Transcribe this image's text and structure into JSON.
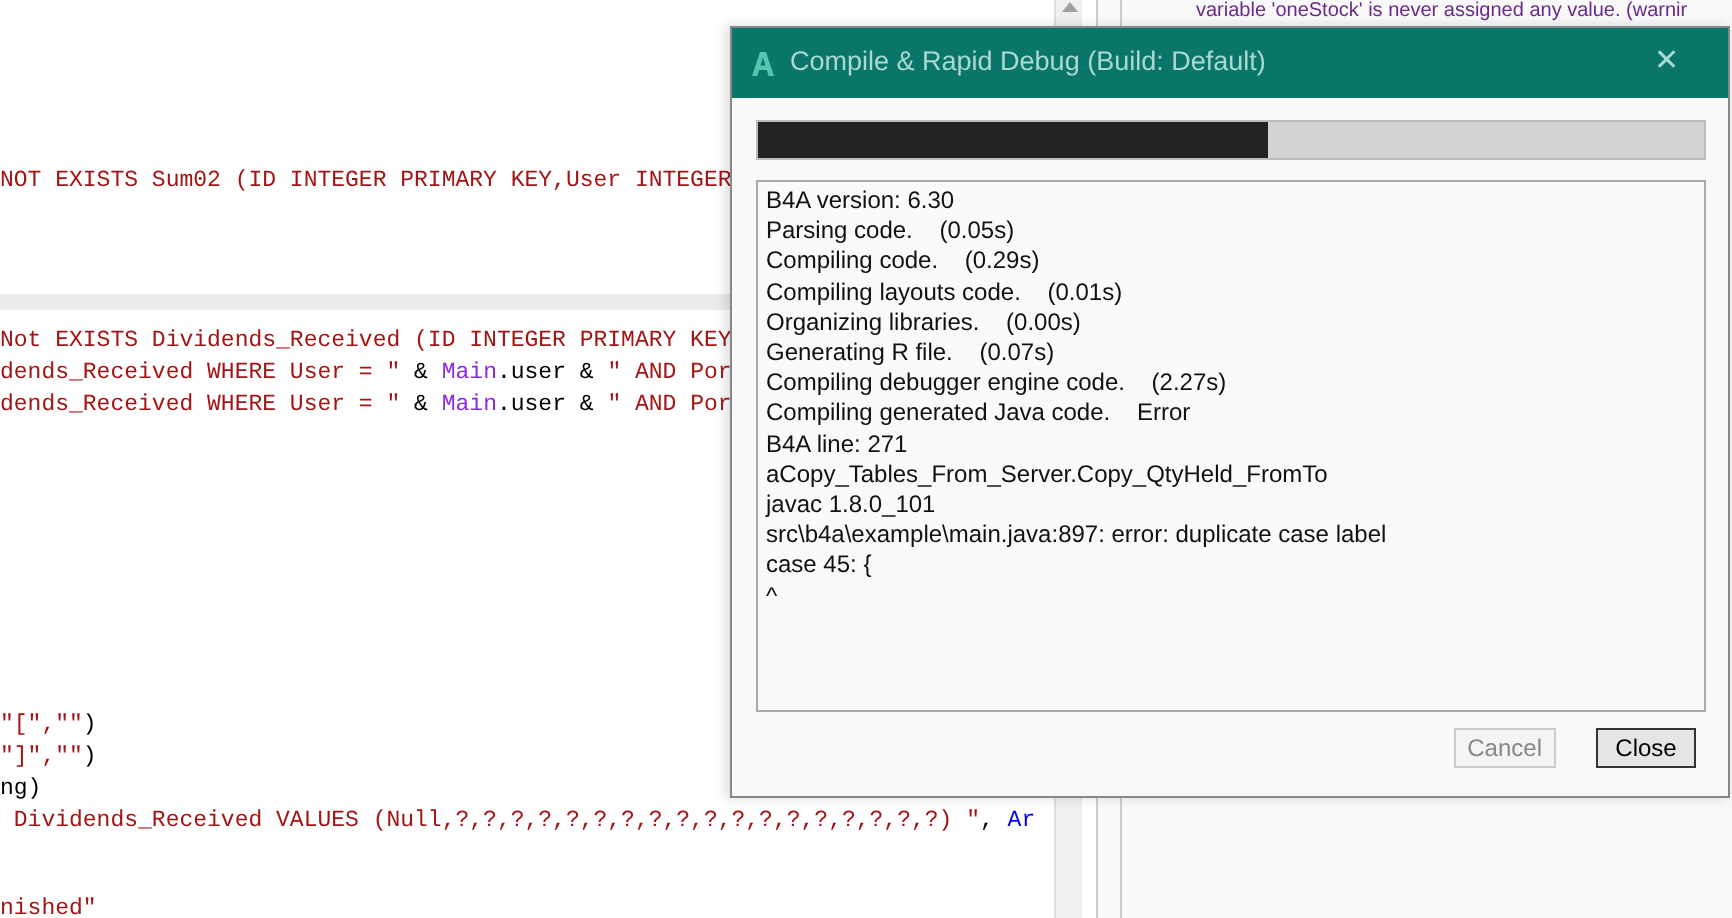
{
  "editor": {
    "groups": [
      {
        "lines": [
          [
            {
              "text": "NOT EXISTS Sum02 (ID INTEGER PRIMARY KEY,User INTEGER",
              "kind": "string"
            }
          ]
        ]
      },
      {
        "lines": [
          [
            {
              "text": "Not EXISTS Dividends_Received (ID INTEGER PRIMARY KEY",
              "kind": "string"
            }
          ],
          [
            {
              "text": "dends_Received WHERE User = \"",
              "kind": "string"
            },
            {
              "text": " & ",
              "kind": "plain"
            },
            {
              "text": "Main",
              "kind": "object"
            },
            {
              "text": ".user & ",
              "kind": "plain"
            },
            {
              "text": "\" AND Por",
              "kind": "string"
            }
          ],
          [
            {
              "text": "dends_Received WHERE User = \"",
              "kind": "string"
            },
            {
              "text": " & ",
              "kind": "plain"
            },
            {
              "text": "Main",
              "kind": "object"
            },
            {
              "text": ".user & ",
              "kind": "plain"
            },
            {
              "text": "\" AND Por",
              "kind": "string"
            }
          ]
        ]
      },
      {
        "lines": [
          [
            {
              "text": "\"[\",\"\"",
              "kind": "string"
            },
            {
              "text": ")",
              "kind": "plain"
            }
          ],
          [
            {
              "text": "\"]\",\"\"",
              "kind": "string"
            },
            {
              "text": ")",
              "kind": "plain"
            }
          ],
          [
            {
              "text": "ng)",
              "kind": "plain"
            }
          ],
          [
            {
              "text": " Dividends_Received VALUES (Null,?,?,?,?,?,?,?,?,?,?,?,?,?,?,?,?,?,?) \"",
              "kind": "string"
            },
            {
              "text": ", ",
              "kind": "plain"
            },
            {
              "text": "Ar",
              "kind": "keyword"
            }
          ]
        ]
      },
      {
        "lines": [
          [
            {
              "text": "nished\"",
              "kind": "string"
            }
          ]
        ]
      }
    ]
  },
  "messages": {
    "text": "variable 'oneStock' is never assigned any value. (warnir"
  },
  "dialog": {
    "title": "Compile & Rapid Debug (Build: Default)",
    "close_glyph": "✕",
    "progress": {
      "level": 0.54
    },
    "log": [
      "B4A version: 6.30",
      "Parsing code.    (0.05s)",
      "Compiling code.    (0.29s)",
      "Compiling layouts code.    (0.01s)",
      "Organizing libraries.    (0.00s)",
      "Generating R file.    (0.07s)",
      "Compiling debugger engine code.    (2.27s)",
      "Compiling generated Java code.    Error",
      "B4A line: 271",
      "aCopy_Tables_From_Server.Copy_QtyHeld_FromTo",
      "javac 1.8.0_101",
      "src\\b4a\\example\\main.java:897: error: duplicate case label",
      "case 45: {",
      "^"
    ],
    "buttons": [
      {
        "label": "Cancel",
        "disabled": true
      },
      {
        "label": "Close",
        "disabled": false
      }
    ]
  }
}
